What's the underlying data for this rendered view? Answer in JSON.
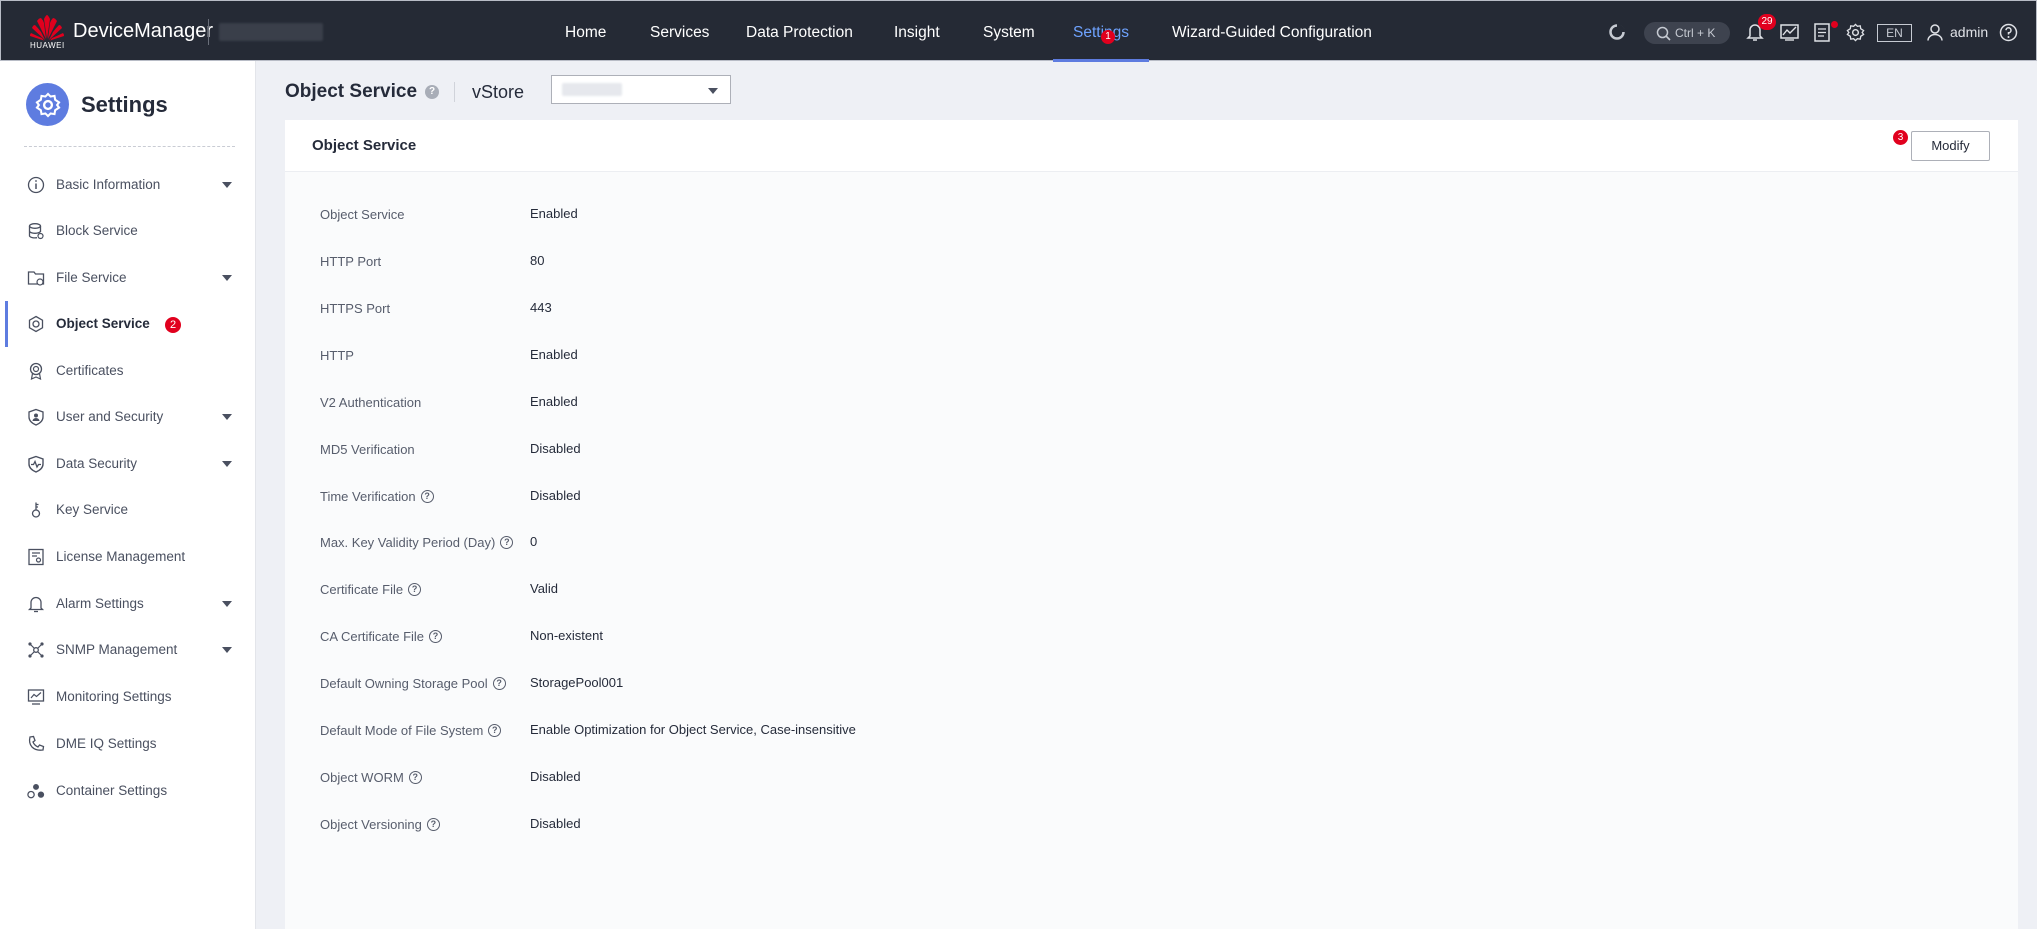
{
  "header": {
    "brand_caption": "HUAWEI",
    "app_name": "DeviceManager",
    "nav": [
      {
        "label": "Home"
      },
      {
        "label": "Services"
      },
      {
        "label": "Data Protection"
      },
      {
        "label": "Insight"
      },
      {
        "label": "System"
      },
      {
        "label": "Settings",
        "active": true
      },
      {
        "label": "Wizard-Guided Configuration"
      }
    ],
    "settings_badge": "1",
    "search_shortcut": "Ctrl + K",
    "alarm_count": "29",
    "language": "EN",
    "user": "admin",
    "icons": [
      "loading-icon",
      "search-icon",
      "bell-icon",
      "performance-icon",
      "task-list-icon",
      "gear-icon",
      "user-icon",
      "help-icon"
    ]
  },
  "sidebar": {
    "title": "Settings",
    "items": [
      {
        "label": "Basic Information",
        "icon": "info-icon",
        "expandable": true
      },
      {
        "label": "Block Service",
        "icon": "database-icon",
        "expandable": false
      },
      {
        "label": "File Service",
        "icon": "folder-icon",
        "expandable": true
      },
      {
        "label": "Object Service",
        "icon": "hexagon-gear-icon",
        "expandable": false,
        "active": true,
        "badge": "2"
      },
      {
        "label": "Certificates",
        "icon": "certificate-icon",
        "expandable": false
      },
      {
        "label": "User and Security",
        "icon": "shield-user-icon",
        "expandable": true
      },
      {
        "label": "Data Security",
        "icon": "shield-pulse-icon",
        "expandable": true
      },
      {
        "label": "Key Service",
        "icon": "key-icon",
        "expandable": false
      },
      {
        "label": "License Management",
        "icon": "license-icon",
        "expandable": false
      },
      {
        "label": "Alarm Settings",
        "icon": "bell-icon",
        "expandable": true
      },
      {
        "label": "SNMP Management",
        "icon": "network-icon",
        "expandable": true
      },
      {
        "label": "Monitoring Settings",
        "icon": "monitor-icon",
        "expandable": false
      },
      {
        "label": "DME IQ Settings",
        "icon": "phone-icon",
        "expandable": false
      },
      {
        "label": "Container Settings",
        "icon": "containers-icon",
        "expandable": false
      }
    ]
  },
  "page": {
    "title": "Object Service",
    "vstore_label": "vStore"
  },
  "card": {
    "title": "Object Service",
    "modify_label": "Modify",
    "modify_badge": "3",
    "rows": [
      {
        "label": "Object Service",
        "value": "Enabled",
        "help": false
      },
      {
        "label": "HTTP Port",
        "value": "80",
        "help": false
      },
      {
        "label": "HTTPS Port",
        "value": "443",
        "help": false
      },
      {
        "label": "HTTP",
        "value": "Enabled",
        "help": false
      },
      {
        "label": "V2 Authentication",
        "value": "Enabled",
        "help": false
      },
      {
        "label": "MD5 Verification",
        "value": "Disabled",
        "help": false
      },
      {
        "label": "Time Verification",
        "value": "Disabled",
        "help": true
      },
      {
        "label": "Max. Key Validity Period (Day)",
        "value": "0",
        "help": true
      },
      {
        "label": "Certificate File",
        "value": "Valid",
        "help": true
      },
      {
        "label": "CA Certificate File",
        "value": "Non-existent",
        "help": true
      },
      {
        "label": "Default Owning Storage Pool",
        "value": "StoragePool001",
        "help": true
      },
      {
        "label": "Default Mode of File System",
        "value": "Enable Optimization for Object Service, Case-insensitive",
        "help": true
      },
      {
        "label": "Object WORM",
        "value": "Disabled",
        "help": true
      },
      {
        "label": "Object Versioning",
        "value": "Disabled",
        "help": true
      }
    ]
  },
  "colors": {
    "topbar": "#252a35",
    "accent": "#5e7ce0",
    "badge": "#e1001e",
    "active_nav": "#6fa3ff"
  }
}
